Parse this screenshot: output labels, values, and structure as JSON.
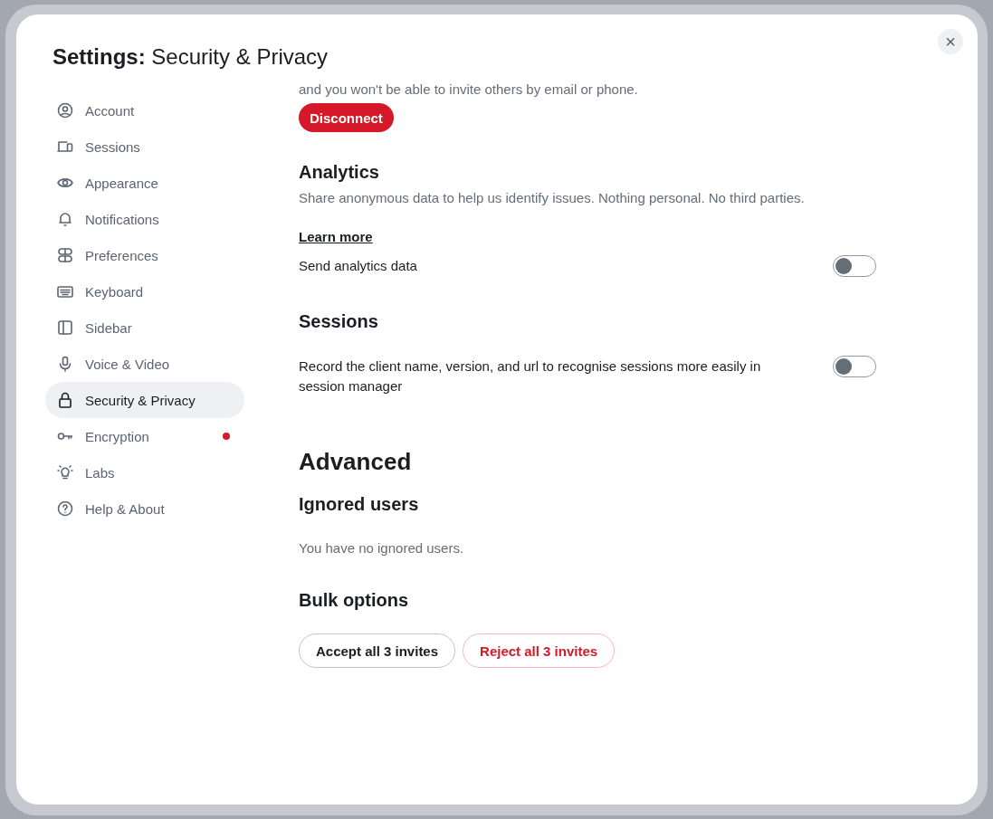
{
  "dialog": {
    "title_prefix": "Settings:",
    "title": "Security & Privacy",
    "close": "×"
  },
  "sidebar": {
    "items": [
      {
        "label": "Account",
        "selected": false,
        "dot": false
      },
      {
        "label": "Sessions",
        "selected": false,
        "dot": false
      },
      {
        "label": "Appearance",
        "selected": false,
        "dot": false
      },
      {
        "label": "Notifications",
        "selected": false,
        "dot": false
      },
      {
        "label": "Preferences",
        "selected": false,
        "dot": false
      },
      {
        "label": "Keyboard",
        "selected": false,
        "dot": false
      },
      {
        "label": "Sidebar",
        "selected": false,
        "dot": false
      },
      {
        "label": "Voice & Video",
        "selected": false,
        "dot": false
      },
      {
        "label": "Security & Privacy",
        "selected": true,
        "dot": false
      },
      {
        "label": "Encryption",
        "selected": false,
        "dot": true
      },
      {
        "label": "Labs",
        "selected": false,
        "dot": false
      },
      {
        "label": "Help & About",
        "selected": false,
        "dot": false
      }
    ]
  },
  "content": {
    "cut_text": "and you won't be able to invite others by email or phone.",
    "disconnect": "Disconnect",
    "analytics": {
      "heading": "Analytics",
      "description": "Share anonymous data to help us identify issues. Nothing personal. No third parties.",
      "link": "Learn more",
      "toggle": {
        "label": "Send analytics data",
        "on": false
      }
    },
    "sessions": {
      "heading": "Sessions",
      "toggle": {
        "label": "Record the client name, version, and url to recognise sessions more easily in session manager",
        "on": false
      }
    },
    "advanced": {
      "heading": "Advanced",
      "ignored_heading": "Ignored users",
      "ignored_text": "You have no ignored users.",
      "bulk_heading": "Bulk options",
      "accept": "Accept all 3 invites",
      "reject": "Reject all 3 invites"
    }
  }
}
